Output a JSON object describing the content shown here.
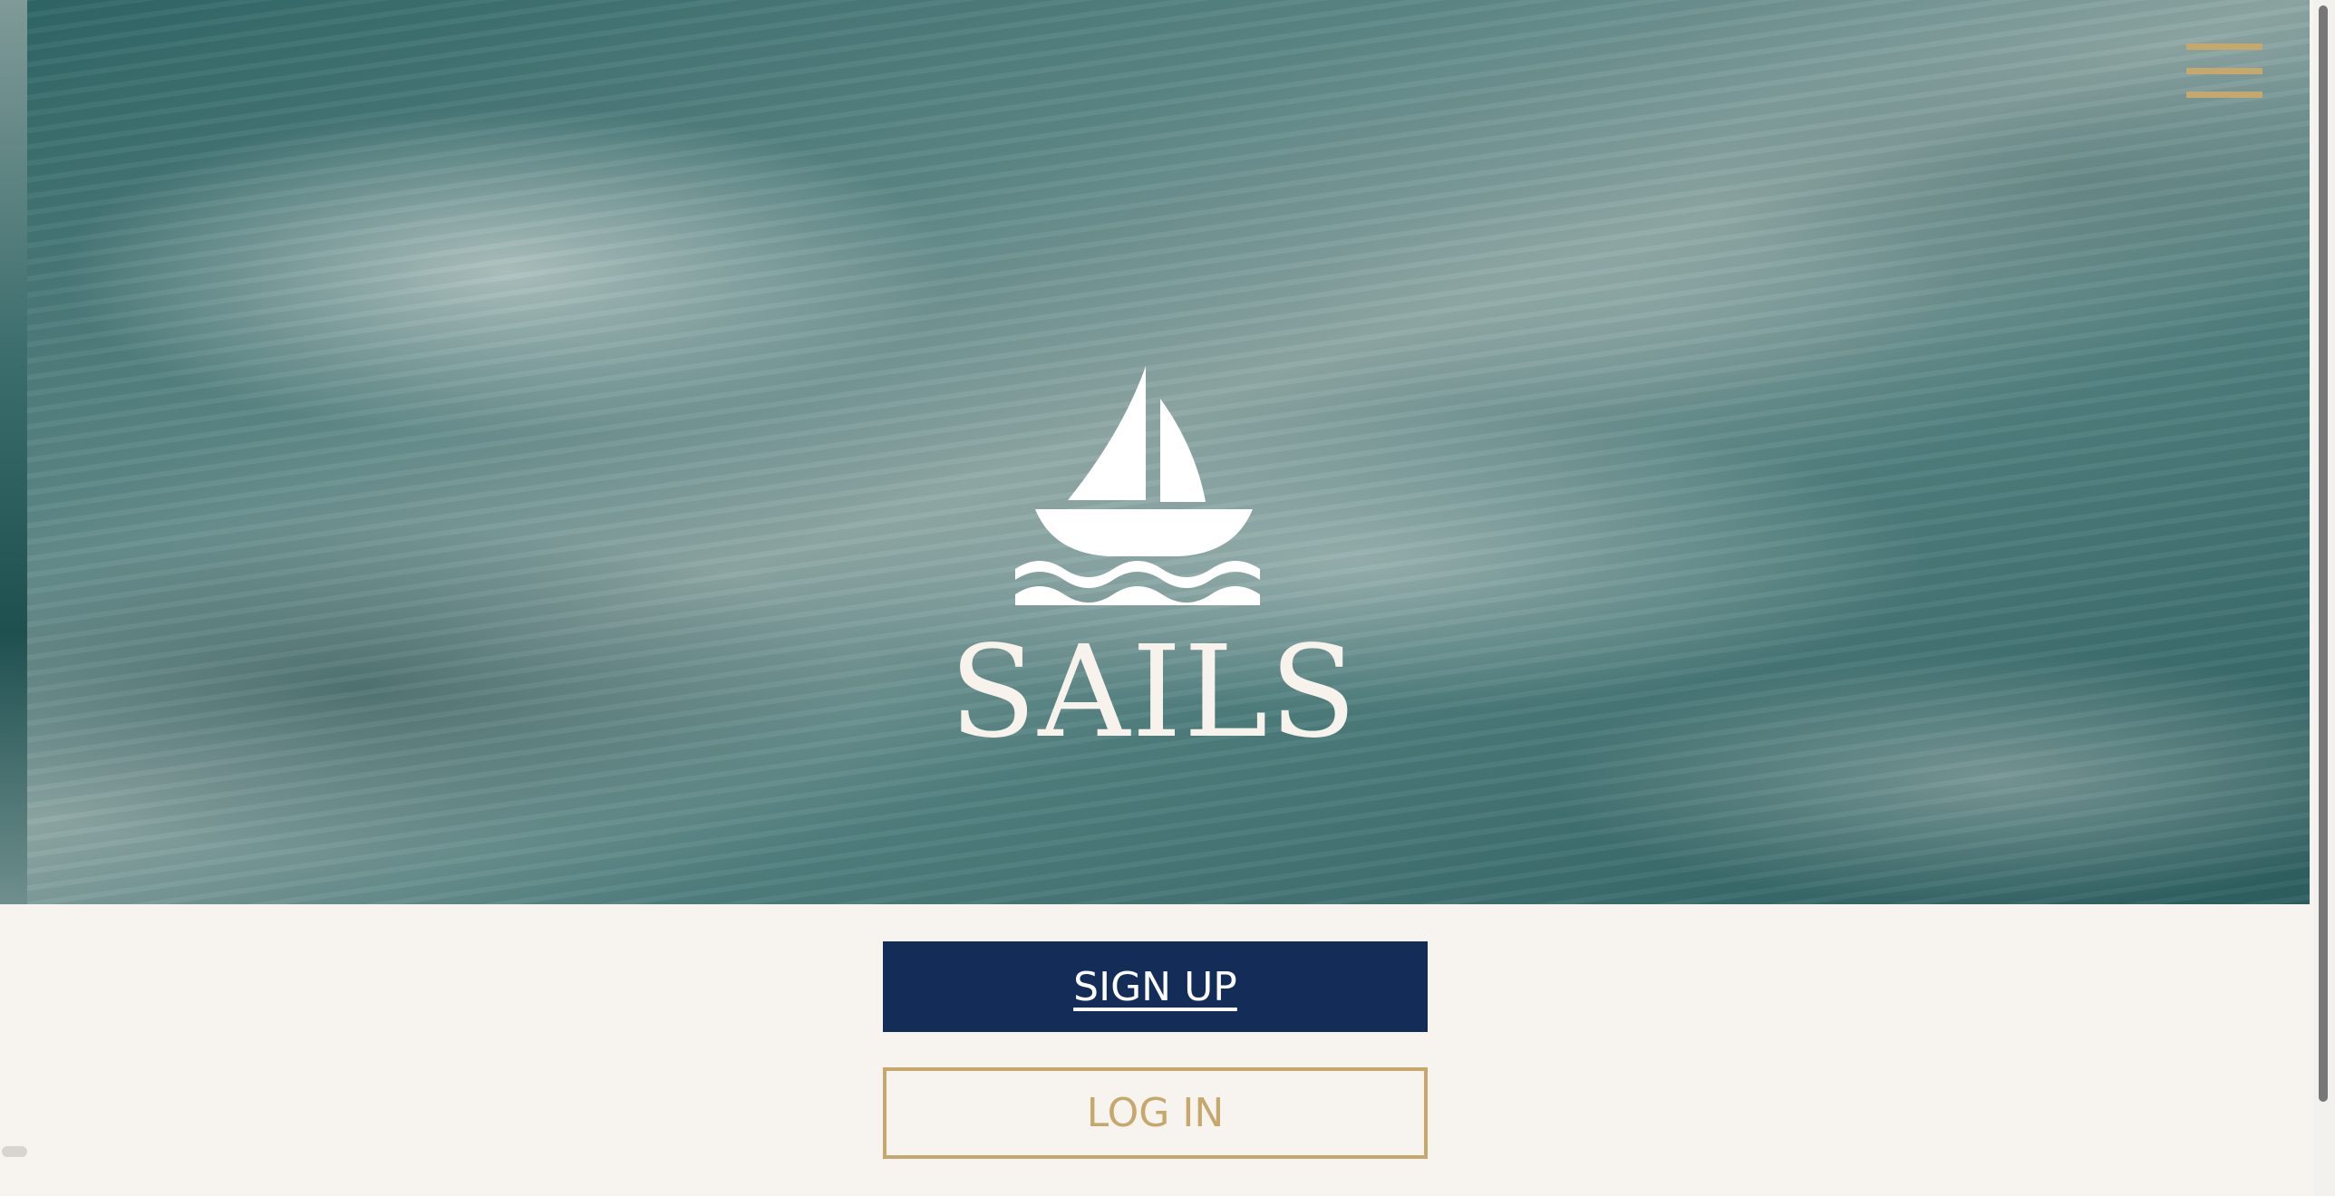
{
  "brand": {
    "name": "SAILS",
    "logo_icon": "sailboat-on-waves-icon"
  },
  "header": {
    "menu_icon": "hamburger-menu-icon"
  },
  "actions": {
    "signup_label": "SIGN UP",
    "login_label": "LOG IN"
  },
  "colors": {
    "navy": "#132d58",
    "gold": "#c6a86c",
    "cream": "#f7f4ef",
    "logo_white": "#f7f3ec"
  }
}
